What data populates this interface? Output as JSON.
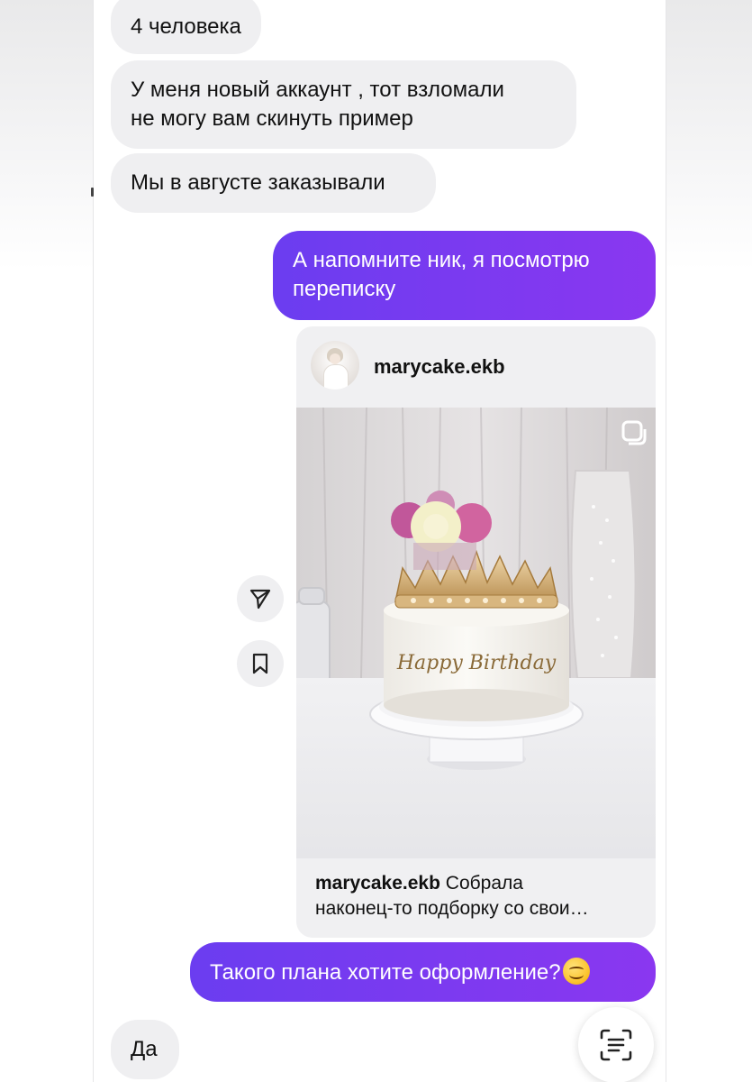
{
  "messages": {
    "m1": "4 человека",
    "m2_line1": "У меня новый аккаунт , тот взломали",
    "m2_line2": "не могу вам скинуть пример",
    "m3": "Мы в августе заказывали",
    "m4_line1": "А напомните ник, я посмотрю",
    "m4_line2": "переписку",
    "m5": "Такого плана хотите оформление?",
    "m6": "Да"
  },
  "post": {
    "username": "marycake.ekb",
    "caption_user": "marycake.ekb",
    "caption_text_1": " Собрала",
    "caption_text_2": "наконец-то подборку со свои…",
    "cake_text": "Happy Birthday"
  },
  "icons": {
    "share": "send-icon",
    "save": "bookmark-icon",
    "carousel": "carousel-icon",
    "scan": "text-scan-icon",
    "emoji": "smiling-face-emoji"
  },
  "colors": {
    "sent_bubble_start": "#6b3df0",
    "sent_bubble_end": "#8a37f0",
    "received_bubble": "#efeff1"
  }
}
